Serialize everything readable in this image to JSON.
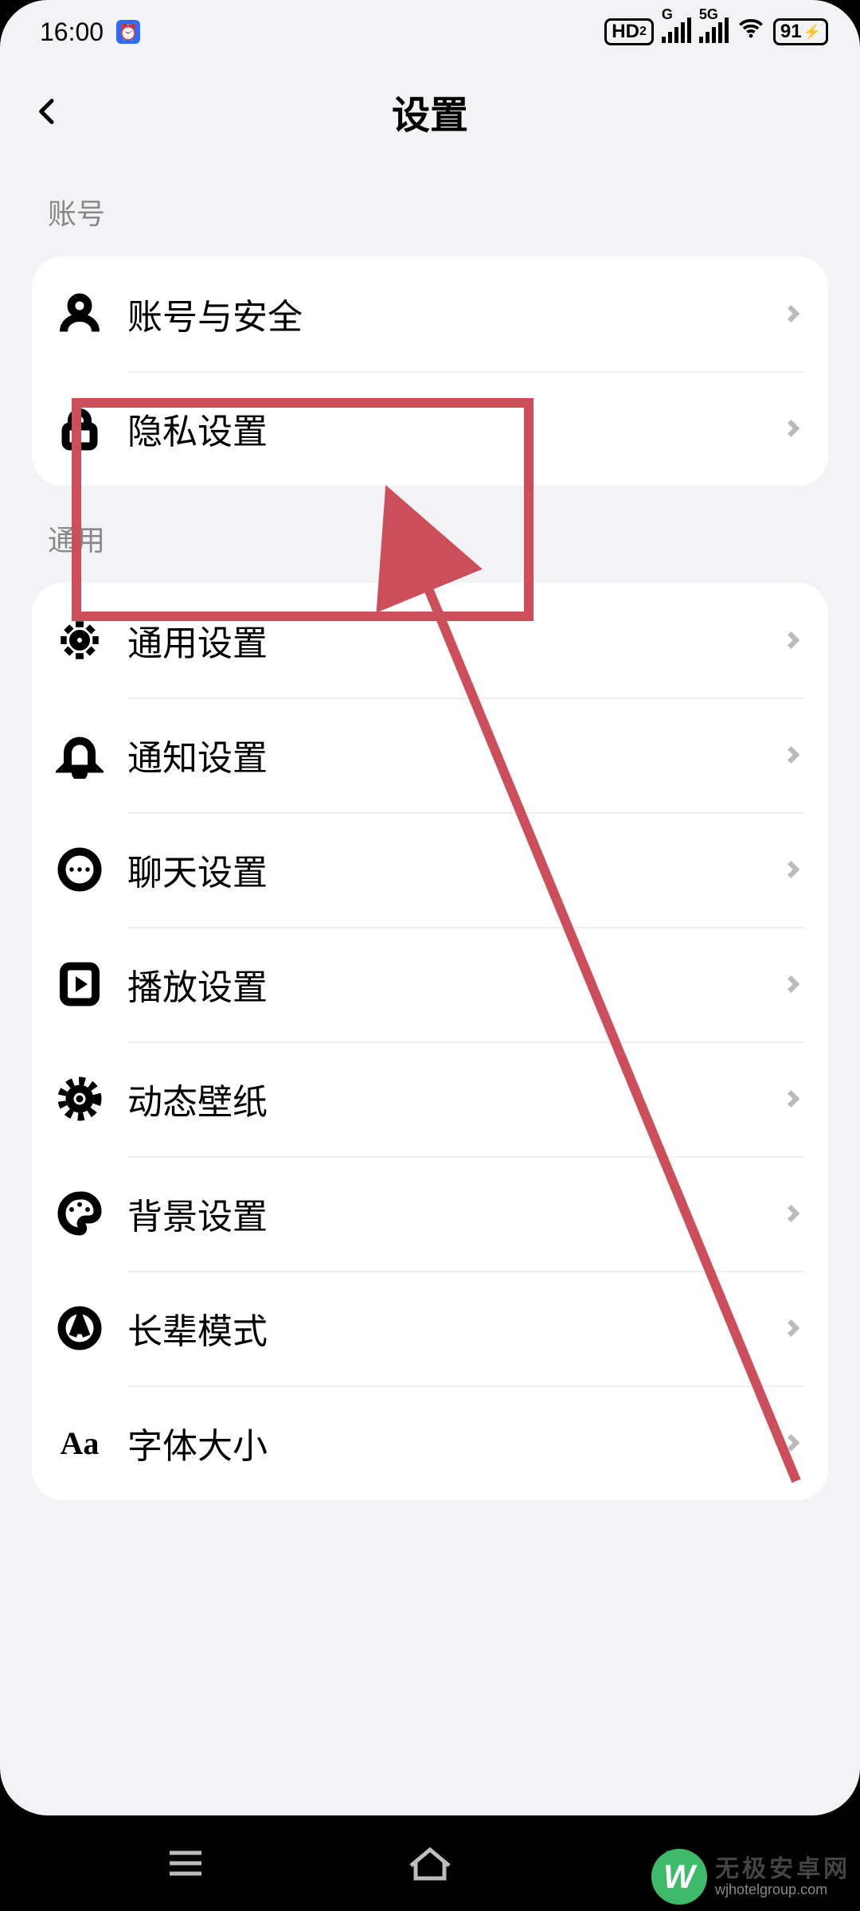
{
  "status": {
    "time": "16:00",
    "hd_label": "HD",
    "hd_sub": "2",
    "sig1_label": "G",
    "sig2_label": "5G",
    "battery_pct": "91"
  },
  "header": {
    "title": "设置"
  },
  "sections": {
    "account": {
      "label": "账号",
      "items": [
        {
          "label": "账号与安全"
        },
        {
          "label": "隐私设置"
        }
      ]
    },
    "general": {
      "label": "通用",
      "items": [
        {
          "label": "通用设置"
        },
        {
          "label": "通知设置"
        },
        {
          "label": "聊天设置"
        },
        {
          "label": "播放设置"
        },
        {
          "label": "动态壁纸"
        },
        {
          "label": "背景设置"
        },
        {
          "label": "长辈模式"
        },
        {
          "label": "字体大小"
        }
      ]
    }
  },
  "watermark": {
    "badge": "W",
    "line1": "无极安卓网",
    "line2": "wjhotelgroup.com"
  }
}
